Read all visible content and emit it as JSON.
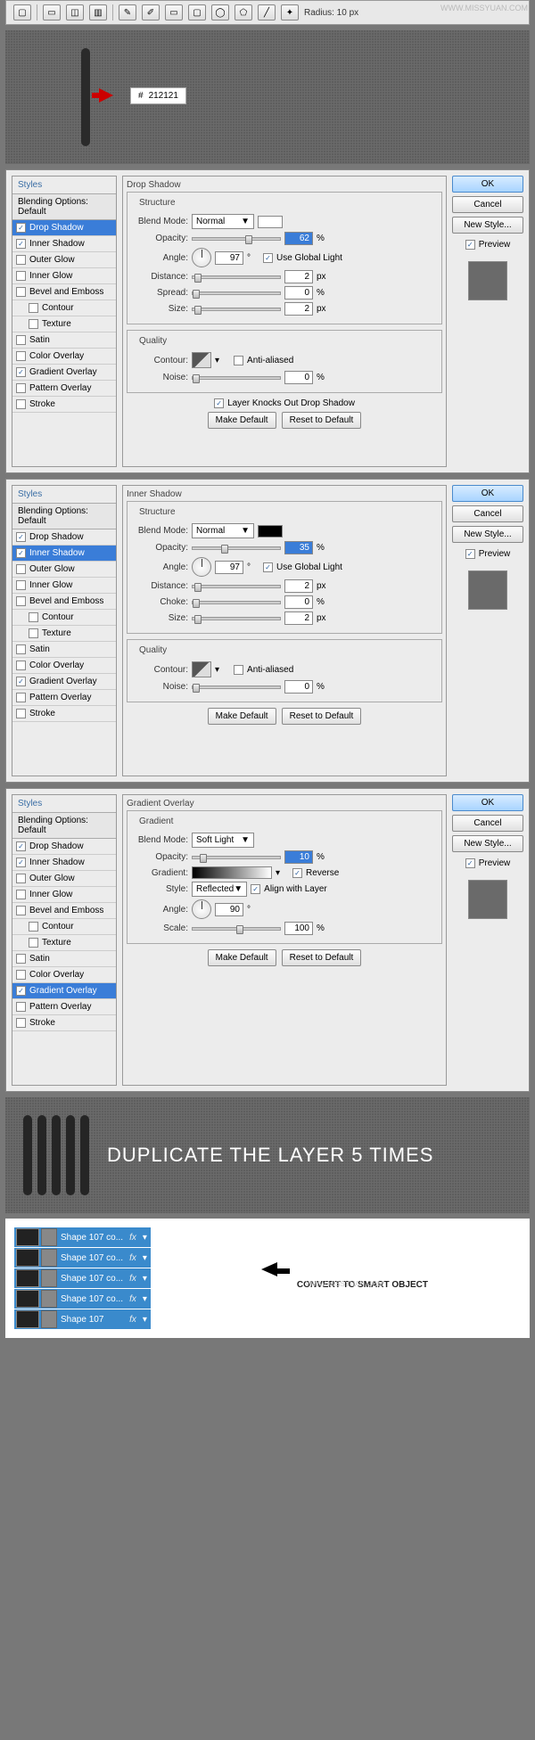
{
  "watermark": "WWW.MISSYUAN.COM",
  "toolbar": {
    "radius_label": "Radius: 10 px"
  },
  "hex": {
    "hash": "#",
    "value": "212121"
  },
  "styles": {
    "header": "Styles",
    "blend_default": "Blending Options: Default",
    "items": [
      "Drop Shadow",
      "Inner Shadow",
      "Outer Glow",
      "Inner Glow",
      "Bevel and Emboss",
      "Contour",
      "Texture",
      "Satin",
      "Color Overlay",
      "Gradient Overlay",
      "Pattern Overlay",
      "Stroke"
    ]
  },
  "right": {
    "ok": "OK",
    "cancel": "Cancel",
    "newstyle": "New Style...",
    "preview": "Preview"
  },
  "ds": {
    "title": "Drop Shadow",
    "structure": "Structure",
    "quality": "Quality",
    "blend": "Blend Mode:",
    "normal": "Normal",
    "opacity": "Opacity:",
    "opv": "62",
    "angle": "Angle:",
    "angv": "97",
    "deg": "°",
    "ugl": "Use Global Light",
    "distance": "Distance:",
    "dv": "2",
    "spread": "Spread:",
    "sv": "0",
    "size": "Size:",
    "szv": "2",
    "contour": "Contour:",
    "aa": "Anti-aliased",
    "noise": "Noise:",
    "nv": "0",
    "knock": "Layer Knocks Out Drop Shadow",
    "makedef": "Make Default",
    "reset": "Reset to Default",
    "px": "px",
    "pct": "%"
  },
  "is": {
    "title": "Inner Shadow",
    "opv": "35",
    "angv": "97",
    "dv": "2",
    "choke": "Choke:",
    "cv": "0",
    "szv": "2",
    "nv": "0"
  },
  "go": {
    "title": "Gradient Overlay",
    "gradient": "Gradient",
    "bmv": "Soft Light",
    "opv": "10",
    "grad": "Gradient:",
    "reverse": "Reverse",
    "style": "Style:",
    "stv": "Reflected",
    "align": "Align with Layer",
    "angle": "Angle:",
    "angv": "90",
    "scale": "Scale:",
    "scv": "100"
  },
  "dup": "DUPLICATE THE LAYER 5 TIMES",
  "layers": {
    "names": [
      "Shape 107 co...",
      "Shape 107 co...",
      "Shape 107 co...",
      "Shape 107 co...",
      "Shape 107"
    ],
    "fx": "fx"
  },
  "smart": "CONVERT TO SMART OBJECT",
  "wm2": "WWW.MISSYUAN.COM"
}
